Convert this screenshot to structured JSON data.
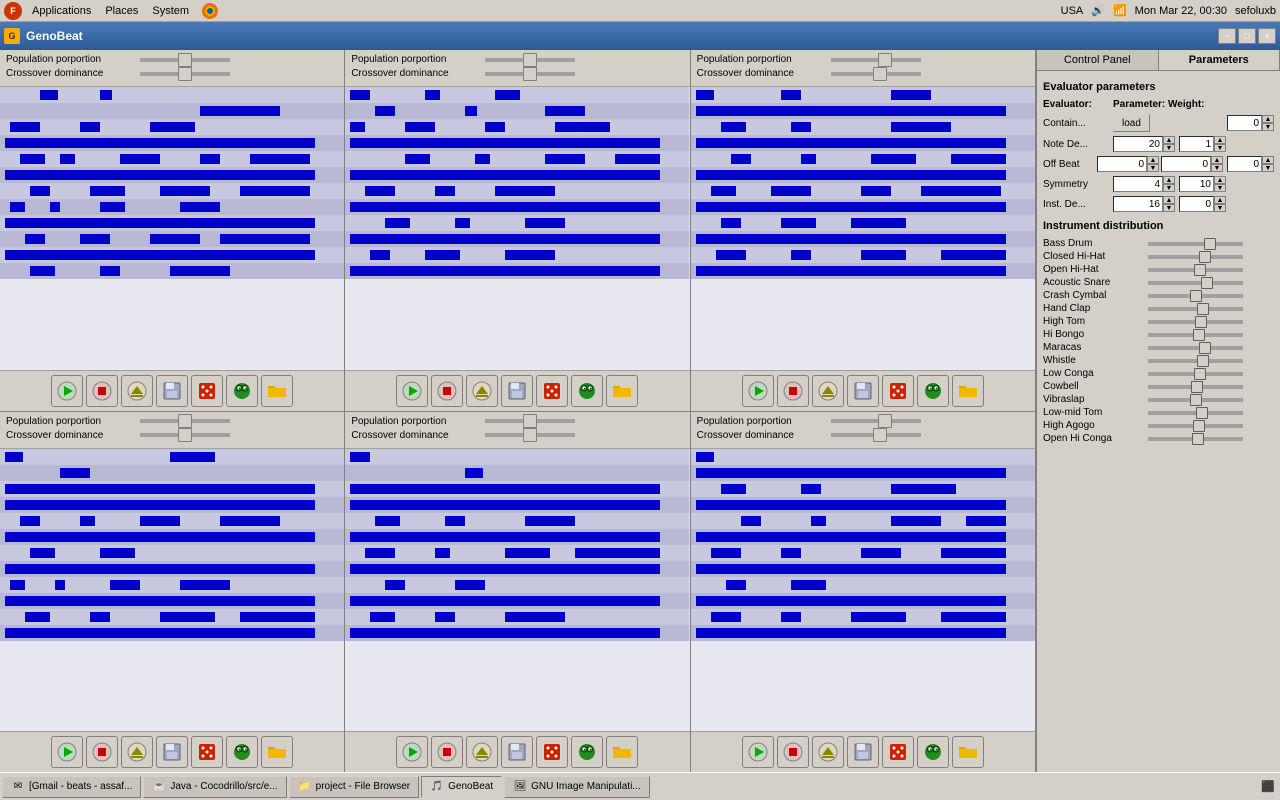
{
  "topbar": {
    "applications": "Applications",
    "places": "Places",
    "system": "System",
    "time": "Mon Mar 22, 00:30",
    "locale": "USA",
    "user": "sefoluxb"
  },
  "titlebar": {
    "title": "GenoBeat",
    "min": "−",
    "max": "□",
    "close": "×"
  },
  "panels": [
    {
      "pop_label": "Population porportion",
      "cross_label": "Crossover dominance",
      "pop_val": 50,
      "cross_val": 50
    },
    {
      "pop_label": "Population porportion",
      "cross_label": "Crossover dominance",
      "pop_val": 50,
      "cross_val": 50
    },
    {
      "pop_label": "Population porportion",
      "cross_label": "Crossover dominance",
      "pop_val": 60,
      "cross_val": 55
    },
    {
      "pop_label": "Population porportion",
      "cross_label": "Crossover dominance",
      "pop_val": 50,
      "cross_val": 50
    },
    {
      "pop_label": "Population porportion",
      "cross_label": "Crossover dominance",
      "pop_val": 50,
      "cross_val": 50
    },
    {
      "pop_label": "Population porportion",
      "cross_label": "Crossover dominance",
      "pop_val": 60,
      "cross_val": 55
    }
  ],
  "toolbar_buttons": {
    "play": "▶",
    "stop": "⏹",
    "eject": "⏏",
    "save": "💾",
    "dice1": "🎲",
    "frog": "🐸",
    "folder": "📁"
  },
  "right_panel": {
    "tabs": [
      "Control Panel",
      "Parameters"
    ],
    "active_tab": 1,
    "eval_title": "Evaluator parameters",
    "eval_header": {
      "evaluator": "Evaluator:",
      "parameter": "Parameter:",
      "weight": "Weight:"
    },
    "params": [
      {
        "name": "Contain...",
        "param_type": "load",
        "param_val": "",
        "weight": "0"
      },
      {
        "name": "Note De...",
        "param_val": "20",
        "weight": "1"
      },
      {
        "name": "Off Beat",
        "param_val1": "0",
        "param_val2": "0",
        "weight": "0"
      },
      {
        "name": "Symmetry",
        "param_val": "4",
        "weight": "10"
      },
      {
        "name": "Inst. De...",
        "param_val": "16",
        "weight": "0"
      }
    ],
    "inst_title": "Instrument distribution",
    "instruments": [
      {
        "name": "Bass Drum",
        "val": 65
      },
      {
        "name": "Closed Hi-Hat",
        "val": 60
      },
      {
        "name": "Open Hi-Hat",
        "val": 55
      },
      {
        "name": "Acoustic Snare",
        "val": 62
      },
      {
        "name": "Crash Cymbal",
        "val": 50
      },
      {
        "name": "Hand Clap",
        "val": 58
      },
      {
        "name": "High Tom",
        "val": 56
      },
      {
        "name": "Hi Bongo",
        "val": 54
      },
      {
        "name": "Maracas",
        "val": 60
      },
      {
        "name": "Whistle",
        "val": 58
      },
      {
        "name": "Low Conga",
        "val": 55
      },
      {
        "name": "Cowbell",
        "val": 52
      },
      {
        "name": "Vibraslap",
        "val": 50
      },
      {
        "name": "Low-mid Tom",
        "val": 57
      },
      {
        "name": "High Agogo",
        "val": 54
      },
      {
        "name": "Open Hi Conga",
        "val": 53
      }
    ]
  },
  "taskbar": {
    "items": [
      {
        "label": "[Gmail - beats - assaf...",
        "icon": "✉",
        "active": false
      },
      {
        "label": "Java - Cocodrillo/src/e...",
        "icon": "☕",
        "active": false
      },
      {
        "label": "project - File Browser",
        "icon": "📁",
        "active": false
      },
      {
        "label": "GenoBeat",
        "icon": "🎵",
        "active": true
      },
      {
        "label": "GNU Image Manipulati...",
        "icon": "🖼",
        "active": false
      }
    ]
  }
}
